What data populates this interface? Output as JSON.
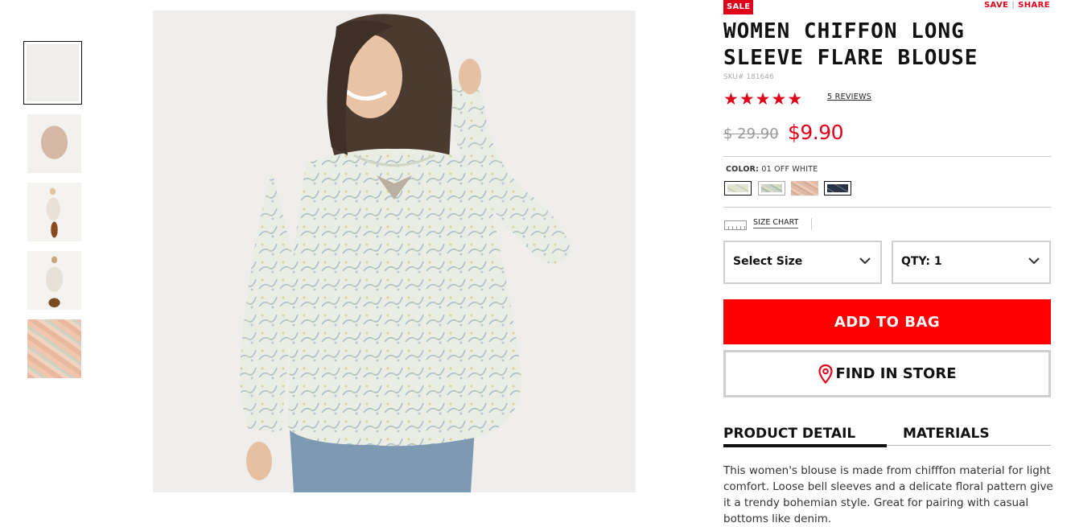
{
  "thumbnails": [
    {
      "name": "thumbnail-front-model",
      "active": true
    },
    {
      "name": "thumbnail-flat-blouse",
      "active": false
    },
    {
      "name": "thumbnail-side-model",
      "active": false
    },
    {
      "name": "thumbnail-back-model",
      "active": false
    },
    {
      "name": "thumbnail-fabric-detail",
      "active": false
    }
  ],
  "badge": "SALE",
  "actions": {
    "save": "SAVE",
    "separator": "|",
    "share": "SHARE"
  },
  "product": {
    "title": "WOMEN CHIFFON LONG SLEEVE FLARE BLOUSE",
    "sku": "SKU# 181646",
    "rating": 5,
    "rating_max": 5,
    "reviews": "5 REVIEWS",
    "old_price": "$ 29.90",
    "new_price": "$9.90",
    "description": "This women's blouse is made from chifffon material for light comfort. Loose bell sleeves and a delicate floral pattern give it a trendy bohemian style. Great for pairing with casual bottoms like denim."
  },
  "color": {
    "label": "COLOR:",
    "value": "01 OFF WHITE",
    "swatches": [
      {
        "name": "swatch-off-white",
        "color": "#dfe2d4",
        "selected": true
      },
      {
        "name": "swatch-light-green",
        "color": "#c9d2c3",
        "selected": false
      },
      {
        "name": "swatch-pink",
        "color": "#e0b9a4",
        "selected": false
      },
      {
        "name": "swatch-navy",
        "color": "#2a3343",
        "selected": false
      }
    ]
  },
  "size_chart": "SIZE CHART",
  "size_select": {
    "label": "Select Size"
  },
  "qty_select": {
    "label": "QTY: 1"
  },
  "buttons": {
    "add_to_bag": "ADD TO BAG",
    "find_in_store": "FIND IN STORE"
  },
  "tabs": [
    {
      "label": "PRODUCT DETAIL",
      "active": true
    },
    {
      "label": "MATERIALS",
      "active": false
    }
  ],
  "colors": {
    "brand_red": "#ff0000",
    "price_red": "#e0001a",
    "border_gray": "#cfcfcf"
  }
}
